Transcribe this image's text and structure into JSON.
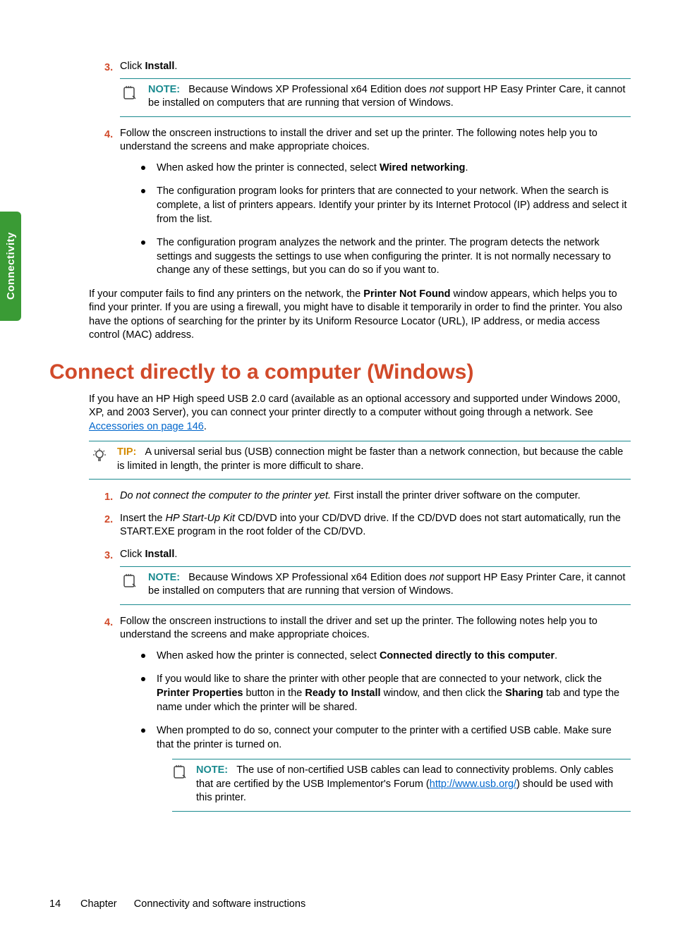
{
  "sideTab": "Connectivity",
  "top": {
    "step3_pre": "Click ",
    "step3_bold": "Install",
    "step3_post": ".",
    "note1_label": "NOTE:",
    "note1_a": "Because Windows XP Professional x64 Edition does ",
    "note1_i": "not",
    "note1_b": " support HP Easy Printer Care, it cannot be installed on computers that are running that version of Windows.",
    "step4": "Follow the onscreen instructions to install the driver and set up the printer. The following notes help you to understand the screens and make appropriate choices.",
    "b1_a": "When asked how the printer is connected, select ",
    "b1_bold": "Wired networking",
    "b1_b": ".",
    "b2": "The configuration program looks for printers that are connected to your network. When the search is complete, a list of printers appears. Identify your printer by its Internet Protocol (IP) address and select it from the list.",
    "b3": "The configuration program analyzes the network and the printer. The program detects the network settings and suggests the settings to use when configuring the printer. It is not normally necessary to change any of these settings, but you can do so if you want to.",
    "after_a": "If your computer fails to find any printers on the network, the ",
    "after_bold": "Printer Not Found",
    "after_b": " window appears, which helps you to find your printer. If you are using a firewall, you might have to disable it temporarily in order to find the printer. You also have the options of searching for the printer by its Uniform Resource Locator (URL), IP address, or media access control (MAC) address."
  },
  "section": {
    "heading": "Connect directly to a computer (Windows)",
    "intro_a": "If you have an HP High speed USB 2.0 card (available as an optional accessory and supported under Windows 2000, XP, and 2003 Server), you can connect your printer directly to a computer without going through a network. See ",
    "intro_link": "Accessories on page 146",
    "intro_b": ".",
    "tip_label": "TIP:",
    "tip_text": "A universal serial bus (USB) connection might be faster than a network connection, but because the cable is limited in length, the printer is more difficult to share.",
    "s1_i": "Do not connect the computer to the printer yet.",
    "s1_b": " First install the printer driver software on the computer.",
    "s2_a": "Insert the ",
    "s2_i": "HP Start-Up Kit",
    "s2_b": " CD/DVD into your CD/DVD drive. If the CD/DVD does not start automatically, run the START.EXE program in the root folder of the CD/DVD.",
    "s3_a": "Click ",
    "s3_bold": "Install",
    "s3_b": ".",
    "note2_label": "NOTE:",
    "note2_a": "Because Windows XP Professional x64 Edition does ",
    "note2_i": "not",
    "note2_b": " support HP Easy Printer Care, it cannot be installed on computers that are running that version of Windows.",
    "s4": "Follow the onscreen instructions to install the driver and set up the printer. The following notes help you to understand the screens and make appropriate choices.",
    "sb1_a": "When asked how the printer is connected, select ",
    "sb1_bold": "Connected directly to this computer",
    "sb1_b": ".",
    "sb2_a": "If you would like to share the printer with other people that are connected to your network, click the ",
    "sb2_bold1": "Printer Properties",
    "sb2_b": " button in the ",
    "sb2_bold2": "Ready to Install",
    "sb2_c": " window, and then click the ",
    "sb2_bold3": "Sharing",
    "sb2_d": " tab and type the name under which the printer will be shared.",
    "sb3": "When prompted to do so, connect your computer to the printer with a certified USB cable. Make sure that the printer is turned on.",
    "note3_label": "NOTE:",
    "note3_a": "The use of non-certified USB cables can lead to connectivity problems. Only cables that are certified by the USB Implementor's Forum (",
    "note3_link": "http://www.usb.org/",
    "note3_b": ") should be used with this printer."
  },
  "footer": {
    "page": "14",
    "chapter": "Chapter",
    "title": "Connectivity and software instructions"
  }
}
